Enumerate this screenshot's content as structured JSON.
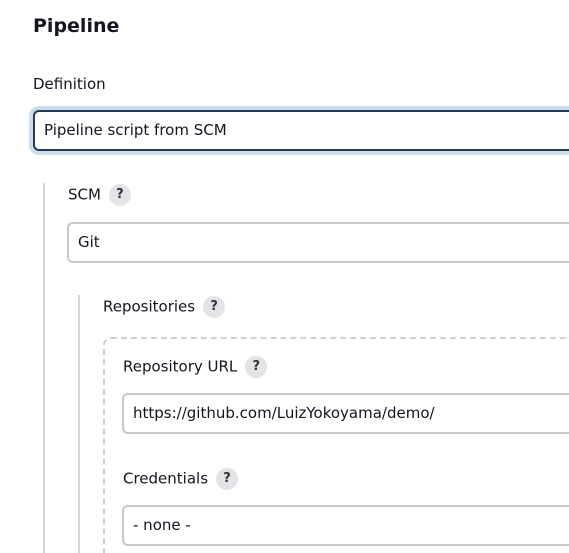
{
  "section": {
    "title": "Pipeline"
  },
  "definition": {
    "label": "Definition",
    "value": "Pipeline script from SCM"
  },
  "scm": {
    "label": "SCM",
    "help": "?",
    "value": "Git"
  },
  "repositories": {
    "label": "Repositories",
    "help": "?"
  },
  "repository_url": {
    "label": "Repository URL",
    "help": "?",
    "value": "https://github.com/LuizYokoyama/demo/"
  },
  "credentials": {
    "label": "Credentials",
    "help": "?",
    "value": "- none -"
  },
  "colors": {
    "focus_border": "#1d3d5a",
    "focus_ring": "#cfdbe8",
    "help_bg": "#e4e4e8",
    "field_border": "#c7c7cc"
  }
}
